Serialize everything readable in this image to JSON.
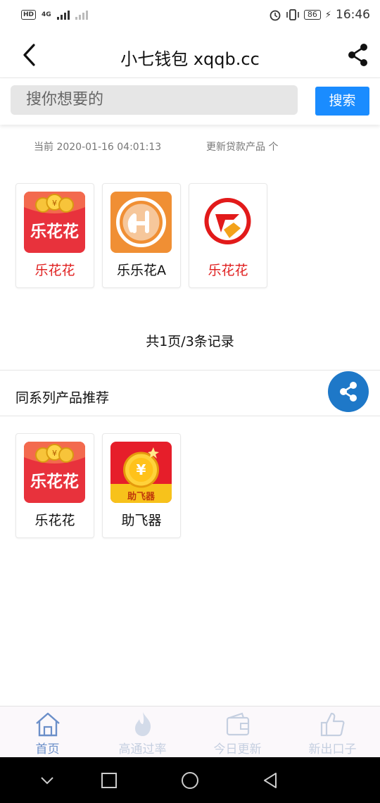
{
  "status_bar": {
    "network": "4G",
    "battery": "86",
    "time": "16:46"
  },
  "header": {
    "title": "小七钱包 xqqb.cc",
    "back_icon": "back-arrow-icon",
    "share_icon": "share-icon"
  },
  "search": {
    "placeholder": "搜你想要的",
    "button_label": "搜索"
  },
  "meta": {
    "current": "当前 2020-01-16 04:01:13",
    "update": "更新贷款产品 个"
  },
  "products": [
    {
      "name": "乐花花",
      "color": "#e02020",
      "icon": "lehuahua-icon"
    },
    {
      "name": "乐乐花A",
      "color": "#111111",
      "icon": "lelehua-icon"
    },
    {
      "name": "乐花花",
      "color": "#e02020",
      "icon": "lehuahua-alt-icon"
    }
  ],
  "pagination": {
    "text": "共1页/3条记录"
  },
  "recommend": {
    "title": "同系列产品推荐",
    "items": [
      {
        "name": "乐花花",
        "icon": "lehuahua-icon"
      },
      {
        "name": "助飞器",
        "icon": "zhufeiqi-icon",
        "icon_text": "助飞器"
      }
    ]
  },
  "bottom_nav": [
    {
      "label": "首页",
      "icon": "home-icon",
      "active": true
    },
    {
      "label": "高通过率",
      "icon": "flame-icon",
      "active": false
    },
    {
      "label": "今日更新",
      "icon": "wallet-icon",
      "active": false
    },
    {
      "label": "新出口子",
      "icon": "thumbs-up-icon",
      "active": false
    }
  ],
  "colors": {
    "accent": "#1a8cff",
    "share_fab": "#1e78c8",
    "nav_active": "#6b8fc9",
    "nav_inactive": "#c5cfe0",
    "red": "#e02020"
  }
}
